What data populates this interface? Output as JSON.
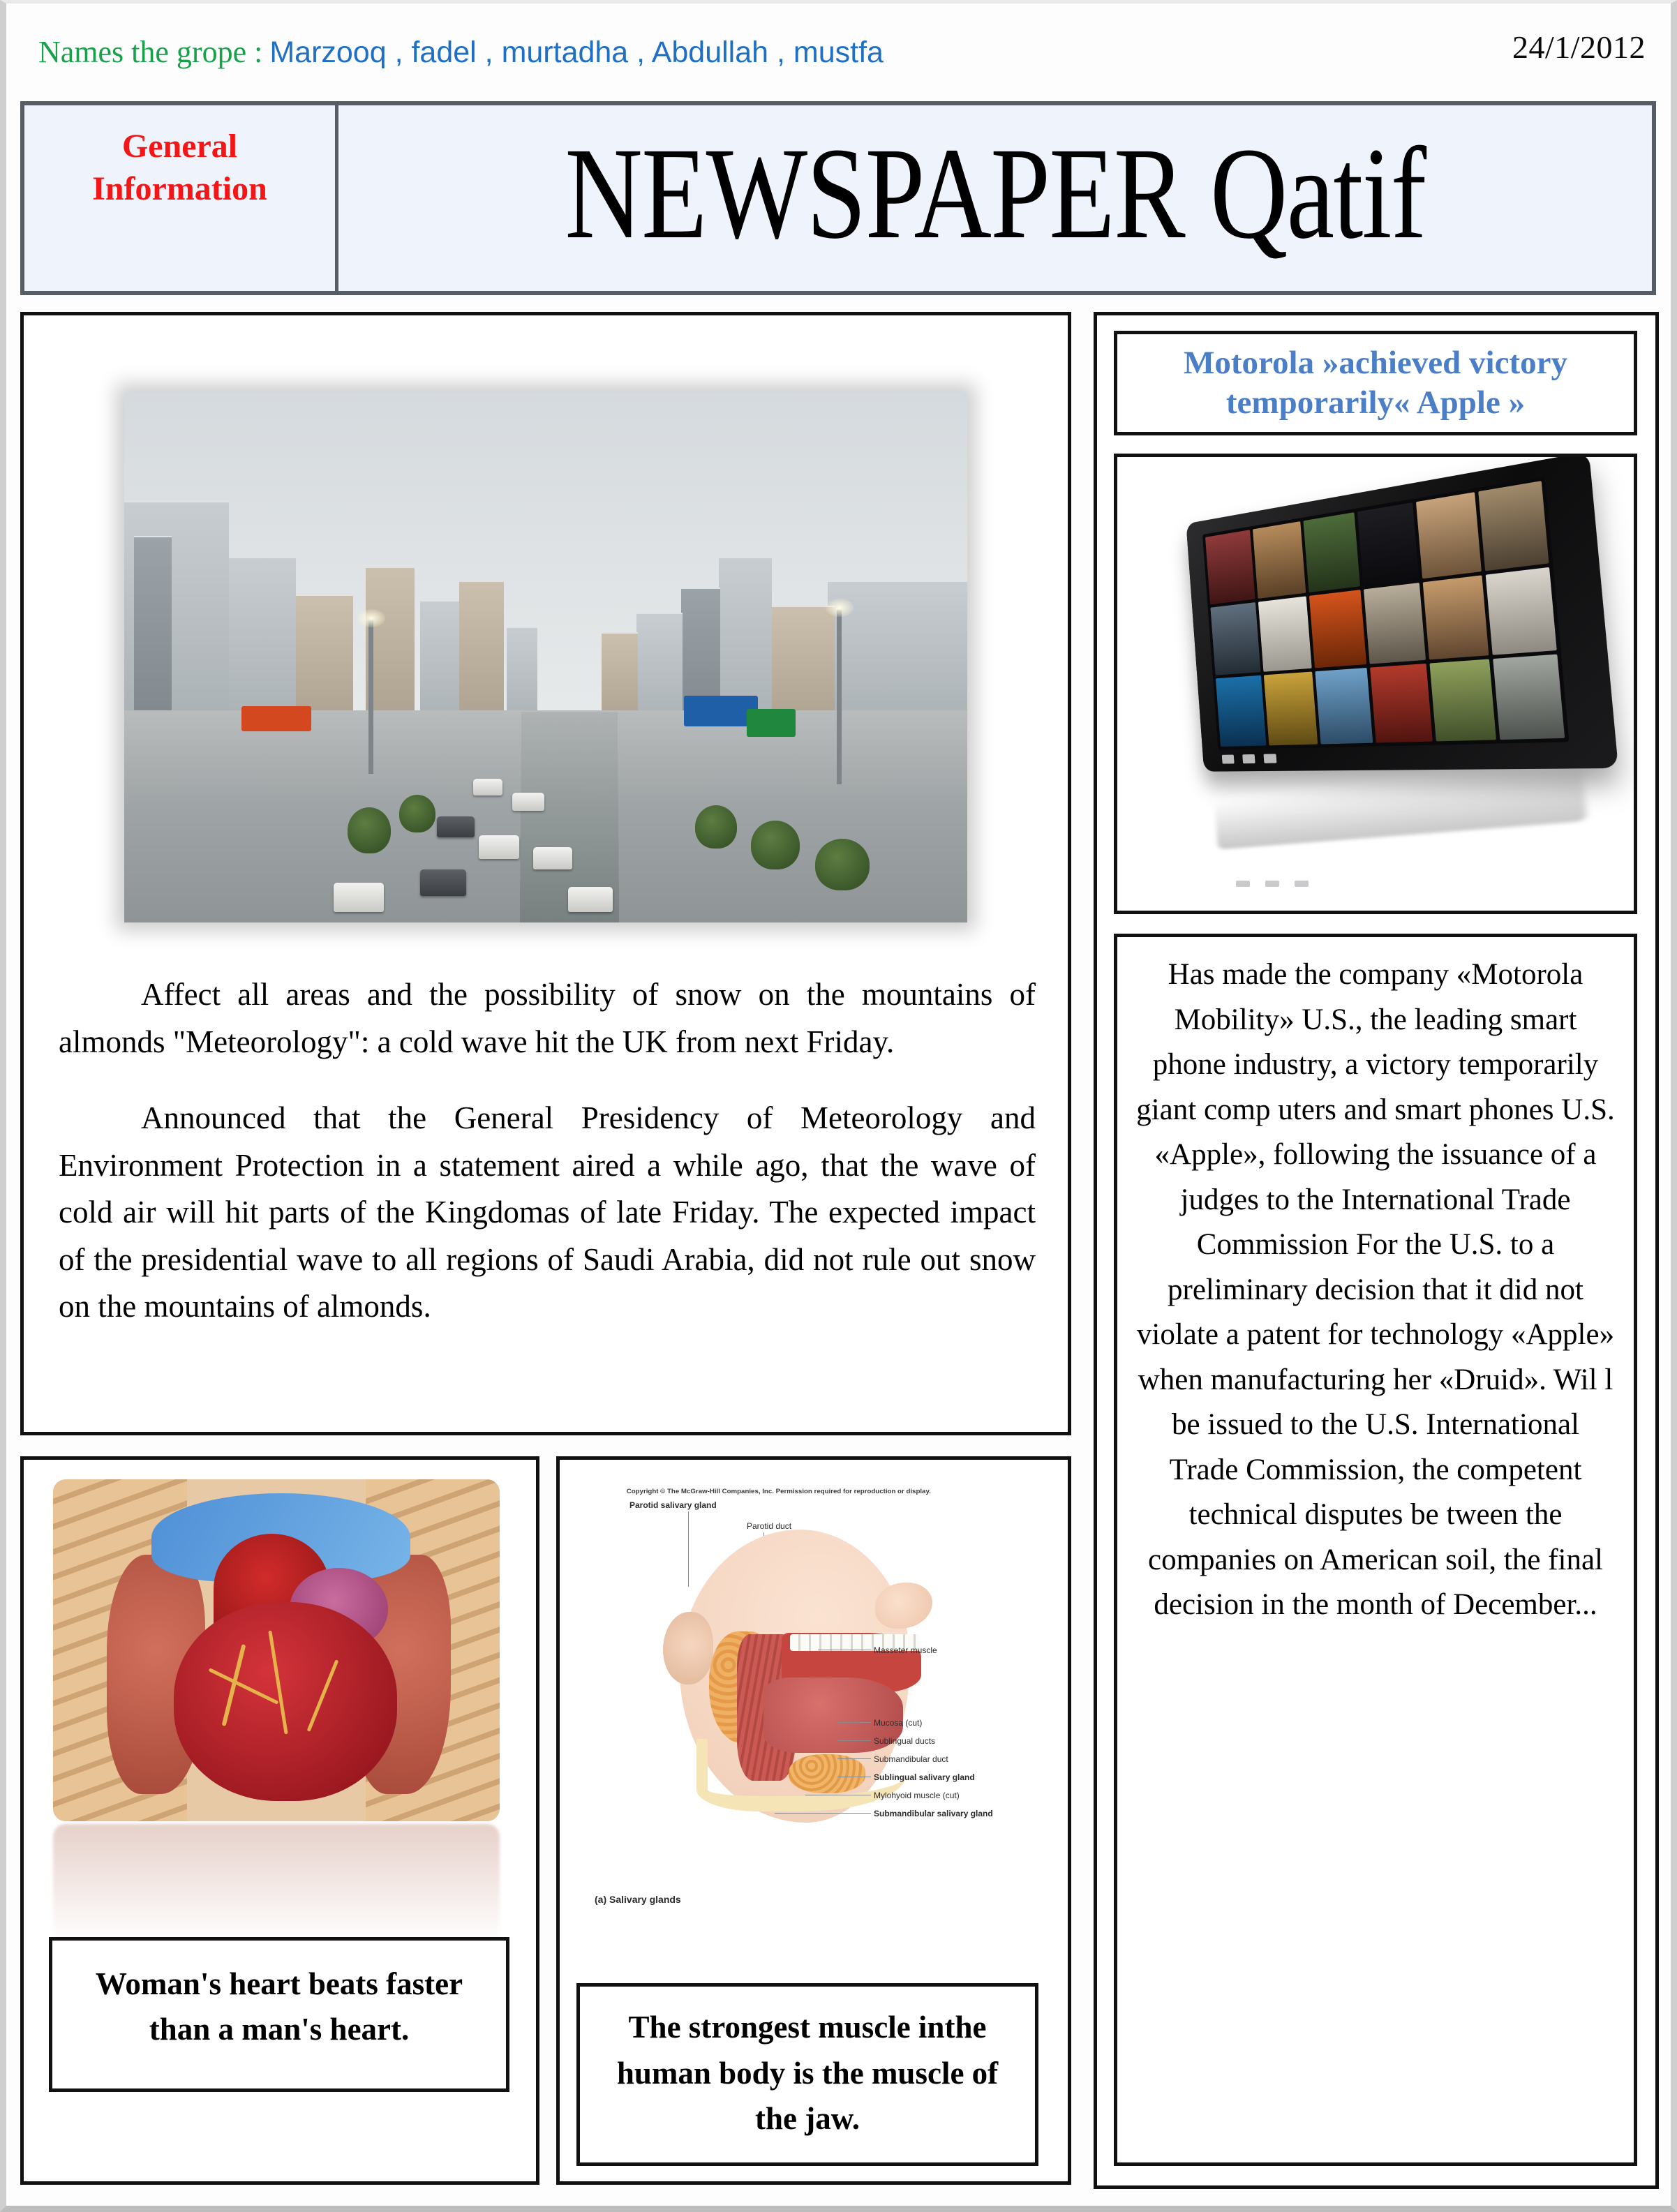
{
  "masthead": {
    "names_label": "Names the grope :",
    "names_values": "Marzooq , fadel , murtadha , Abdullah , mustfa",
    "date": "24/1/2012",
    "general_info_line1": "General",
    "general_info_line2": "Information",
    "paper_title": "NEWSPAPER Qatif",
    "colors": {
      "names_label": "#18a04a",
      "names_values": "#1f6fc4",
      "general_info": "#f41616",
      "title_bar_bg": "#eef3fc",
      "title_bar_border": "#575d66"
    }
  },
  "lead_article": {
    "photo_alt": "rainy city street with skyscrapers and traffic",
    "paragraph_1": "Affect all areas and the possibility of snow on the mountains of almonds      \"Meteorology\": a   cold   wave hit   the UK from next Friday.",
    "paragraph_2": "Announced   that the   General   Presidency of   Meteorology and Environment  Protection  in  a  statement aired a  while  ago, that the  wave  of cold  air will  hit parts  of  the  Kingdomas  of late Friday. The expected impact of the  presidential wave to  all  regions of Saudi Arabia, did not rule out snow on the mountains of almonds."
  },
  "heart_panel": {
    "image_alt": "anatomical illustration of human heart inside ribcage",
    "caption": "Woman's heart beats faster than a man's heart."
  },
  "jaw_panel": {
    "image_alt": "medical diagram of salivary glands in human head",
    "copyright": "Copyright © The McGraw-Hill Companies, Inc. Permission required for reproduction or display.",
    "figure_caption": "(a) Salivary glands",
    "labels": [
      "Parotid salivary gland",
      "Parotid duct",
      "Masseter muscle",
      "Mucosa (cut)",
      "Sublingual ducts",
      "Submandibular duct",
      "Sublingual salivary gland",
      "Mylohyoid muscle (cut)",
      "Submandibular salivary gland"
    ],
    "caption": "The strongest muscle inthe human body is the muscle of the jaw."
  },
  "motorola_panel": {
    "headline": "Motorola »achieved victory temporarily« Apple »",
    "headline_color": "#4a7ec6",
    "image_alt": "Motorola Xoom tablet displaying media thumbnail grid with reflection",
    "body": "Has made the company «Motorola Mobility» U.S., the leading smart phone industry, a victory temporarily giant comp uters and smart phones U.S. «Apple», following the issuance of a judges to the International Trade Commission  For the U.S. to a preliminary decision that it did not violate a patent for technology «Apple» when manufacturing her «Druid». Wil l be issued to the U.S. International Trade Commission, the competent technical disputes be tween the companies on American soil, the final decision in the month of December..."
  }
}
